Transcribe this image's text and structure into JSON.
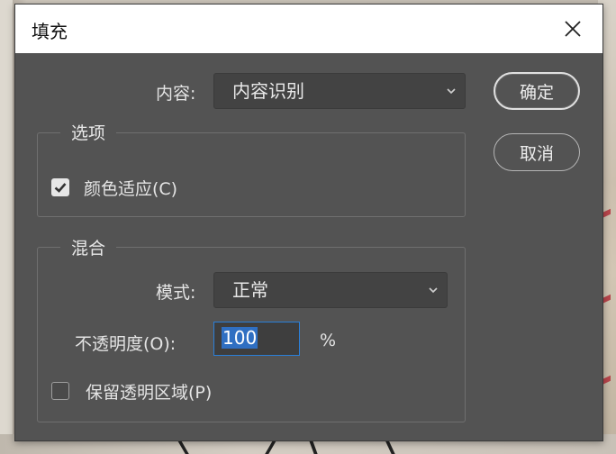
{
  "dialog": {
    "title": "填充",
    "close_icon": "close-icon"
  },
  "content": {
    "label": "内容:",
    "selected": "内容识别"
  },
  "options": {
    "legend": "选项",
    "color_adapt_label": "颜色适应(C)",
    "color_adapt_checked": true
  },
  "blend": {
    "legend": "混合",
    "mode_label": "模式:",
    "mode_selected": "正常",
    "opacity_label": "不透明度(O):",
    "opacity_value": "100",
    "opacity_unit": "%",
    "preserve_label": "保留透明区域(P)",
    "preserve_checked": false
  },
  "buttons": {
    "ok": "确定",
    "cancel": "取消"
  },
  "colors": {
    "dialog_bg": "#535353",
    "accent": "#2a7fd8"
  }
}
